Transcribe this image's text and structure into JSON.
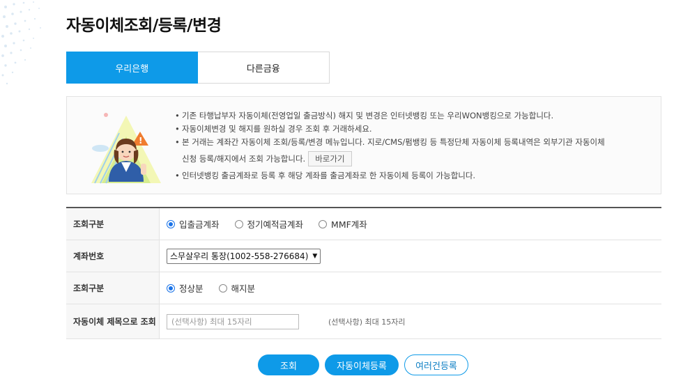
{
  "page": {
    "title": "자동이체조회/등록/변경"
  },
  "tabs": [
    {
      "label": "우리은행",
      "active": true
    },
    {
      "label": "다른금융",
      "active": false
    }
  ],
  "notice": {
    "items": [
      "기존 타행납부자 자동이체(전영업일 출금방식) 해지 및 변경은 인터넷뱅킹 또는 우리WON뱅킹으로 가능합니다.",
      "자동이체변경 및 해지를 원하실 경우 조회 후 거래하세요.",
      "본 거래는 계좌간 자동이체 조회/등록/변경 메뉴입니다. 지로/CMS/펌뱅킹 등 특정단체 자동이체 등록내역은 외부기관 자동이체",
      "신청 등록/해지에서 조회 가능합니다.",
      "인터넷뱅킹 출금계좌로 등록 후 해당 계좌를 출금계좌로 한 자동이체 등록이 가능합니다."
    ],
    "goto_label": "바로가기"
  },
  "form": {
    "rows": [
      {
        "label": "조회구분",
        "options": [
          "입출금계좌",
          "정기예적금계좌",
          "MMF계좌"
        ],
        "selected": 0
      },
      {
        "label": "계좌번호",
        "select_value": "스무살우리 통장(1002-558-276684)"
      },
      {
        "label": "조회구분",
        "options": [
          "정상분",
          "해지분"
        ],
        "selected": 0
      },
      {
        "label": "자동이체 제목으로 조회",
        "placeholder": "(선택사항) 최대 15자리",
        "hint": "(선택사항) 최대 15자리"
      }
    ]
  },
  "buttons": {
    "search": "조회",
    "register": "자동이체등록",
    "multi": "여러건등록"
  },
  "colors": {
    "primary": "#0e9ae8",
    "radio_checked": "#1a73e8"
  }
}
